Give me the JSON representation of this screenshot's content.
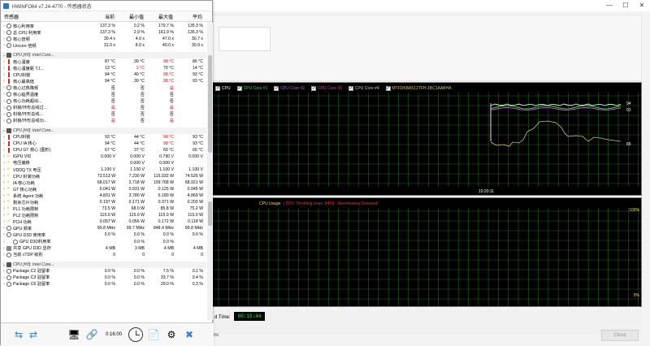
{
  "hwinfo": {
    "title": "HWiNFO64 v7.24-4770 - 传感器状态",
    "columns": [
      "传感器",
      "当前",
      "最小值",
      "最大值",
      "平均"
    ],
    "rows": [
      {
        "type": "item",
        "icon": "circle",
        "name": "核心利用率",
        "v": [
          "137.3 %",
          "0.2 %",
          "179.7 %",
          "135.3 %"
        ],
        "red": []
      },
      {
        "type": "item",
        "icon": "circle",
        "name": "总 CPU 利用率",
        "v": [
          "137.3 %",
          "2.9 %",
          "161.9 %",
          "135.3 %"
        ],
        "red": []
      },
      {
        "type": "item",
        "icon": "circle",
        "name": "核心倍频",
        "v": [
          "30.4 x",
          "4.0 x",
          "47.0 x",
          "30.7 x"
        ],
        "red": []
      },
      {
        "type": "item",
        "icon": "circle",
        "name": "Uncore 倍频",
        "v": [
          "31.0 x",
          "8.0 x",
          "40.0 x",
          "30.9 x"
        ],
        "red": []
      },
      {
        "type": "blank"
      },
      {
        "type": "group",
        "name": "CPU [#0]: Intel Core..."
      },
      {
        "type": "item",
        "icon": "therm",
        "name": "核心温度",
        "v": [
          "87 °C",
          "30 °C",
          "98 °C",
          "86 °C"
        ],
        "red": [
          2
        ]
      },
      {
        "type": "item",
        "icon": "therm",
        "name": "核心温度距 TJ...",
        "v": [
          "13 °C",
          "2 °C",
          "70 °C",
          "14 °C"
        ],
        "red": [
          1
        ]
      },
      {
        "type": "item",
        "icon": "therm",
        "name": "CPU封装",
        "v": [
          "94 °C",
          "40 °C",
          "98 °C",
          "93 °C"
        ],
        "red": [
          2
        ]
      },
      {
        "type": "item",
        "icon": "therm",
        "name": "核心最高值",
        "v": [
          "94 °C",
          "39 °C",
          "98 °C",
          "93 °C"
        ],
        "red": [
          2
        ]
      },
      {
        "type": "item",
        "icon": "circle",
        "name": "核心过热降频",
        "v": [
          "否",
          "否",
          "是",
          ""
        ],
        "red": [
          2
        ]
      },
      {
        "type": "item",
        "icon": "circle",
        "name": "核心临界温度",
        "v": [
          "否",
          "否",
          "否",
          ""
        ],
        "red": []
      },
      {
        "type": "item",
        "icon": "circle",
        "name": "核心功耗超出...",
        "v": [
          "否",
          "否",
          "否",
          ""
        ],
        "red": []
      },
      {
        "type": "item",
        "icon": "circle",
        "name": "封装/环形总线过...",
        "v": [
          "是",
          "否",
          "是",
          ""
        ],
        "red": [
          0,
          2
        ]
      },
      {
        "type": "item",
        "icon": "circle",
        "name": "封装/环形总线...",
        "v": [
          "否",
          "否",
          "否",
          ""
        ],
        "red": []
      },
      {
        "type": "item",
        "icon": "circle",
        "name": "封装/环形总线功...",
        "v": [
          "是",
          "否",
          "是",
          ""
        ],
        "red": [
          0,
          2
        ]
      },
      {
        "type": "blank"
      },
      {
        "type": "group",
        "name": "CPU [#0]: Intel Core..."
      },
      {
        "type": "item",
        "icon": "therm",
        "name": "CPU封装",
        "v": [
          "93 °C",
          "44 °C",
          "98 °C",
          "93 °C"
        ],
        "red": [
          2
        ]
      },
      {
        "type": "item",
        "icon": "therm",
        "name": "CPU IA 核心",
        "v": [
          "94 °C",
          "44 °C",
          "98 °C",
          "93 °C"
        ],
        "red": [
          2
        ]
      },
      {
        "type": "item",
        "icon": "therm",
        "name": "CPU GT 核心 (图形)",
        "v": [
          "67 °C",
          "37 °C",
          "69 °C",
          "65 °C"
        ],
        "red": []
      },
      {
        "type": "item",
        "icon": "bolt",
        "name": "iGPU VID",
        "v": [
          "0.000 V",
          "0.000 V",
          "0.790 V",
          "0.000 V"
        ],
        "red": []
      },
      {
        "type": "item",
        "icon": "bolt",
        "name": "电压偏移",
        "v": [
          "",
          "0.000 V",
          "0.000 V",
          ""
        ],
        "red": []
      },
      {
        "type": "item",
        "icon": "bolt",
        "name": "VDDQ TX 电压",
        "v": [
          "1.100 V",
          "1.100 V",
          "1.100 V",
          "1.100 V"
        ],
        "red": []
      },
      {
        "type": "item",
        "icon": "bolt",
        "name": "CPU 封装功耗",
        "v": [
          "73.513 W",
          "7.230 W",
          "115.032 W",
          "74.525 W"
        ],
        "red": []
      },
      {
        "type": "item",
        "icon": "bolt",
        "name": "IA 核心功耗",
        "v": [
          "68.017 W",
          "2.718 W",
          "109.768 W",
          "68.921 W"
        ],
        "red": []
      },
      {
        "type": "item",
        "icon": "bolt",
        "name": "GT 核心功耗",
        "v": [
          "0.041 W",
          "0.031 W",
          "0.125 W",
          "0.045 W"
        ],
        "red": []
      },
      {
        "type": "item",
        "icon": "bolt",
        "name": "系统 Agent 功耗",
        "v": [
          "4.831 W",
          "3.780 W",
          "6.180 W",
          "4.869 W"
        ],
        "red": []
      },
      {
        "type": "item",
        "icon": "bolt",
        "name": "剩余芯片功耗",
        "v": [
          "0.197 W",
          "0.171 W",
          "0.371 W",
          "0.203 W"
        ],
        "red": []
      },
      {
        "type": "item",
        "icon": "bolt",
        "name": "PL1 功耗限制",
        "v": [
          "73.5 W",
          "68.0 W",
          "85.8 W",
          "75.2 W"
        ],
        "red": []
      },
      {
        "type": "item",
        "icon": "bolt",
        "name": "PL2 功耗限制",
        "v": [
          "115.0 W",
          "115.0 W",
          "115.0 W",
          "115.0 W"
        ],
        "red": []
      },
      {
        "type": "item",
        "icon": "bolt",
        "name": "PCH 功耗",
        "v": [
          "0.057 W",
          "0.056 W",
          "0.172 W",
          "0.118 W"
        ],
        "red": []
      },
      {
        "type": "item",
        "icon": "circle",
        "name": "GPU 频率",
        "v": [
          "99.8 MHz",
          "99.7 MHz",
          "848.4 MHz",
          "99.8 MHz"
        ],
        "red": []
      },
      {
        "type": "item",
        "icon": "circle",
        "name": "GPU D3D 使用率",
        "v": [
          "0.0 %",
          "0.0 %",
          "0.0 %",
          "0.0 %"
        ],
        "red": []
      },
      {
        "type": "item",
        "icon": "circle",
        "name": "GPU D3D利用率",
        "v": [
          "",
          "0.0 %",
          "0.0 %",
          ""
        ],
        "red": [],
        "indent": true
      },
      {
        "type": "item",
        "icon": "box",
        "name": "共享 GPU D3D 显存",
        "v": [
          "4 MB",
          "3 MB",
          "4 MB",
          "4 MB"
        ],
        "red": []
      },
      {
        "type": "item",
        "icon": "circle",
        "name": "当前 cTDP 级别",
        "v": [
          "0",
          "0",
          "0",
          "0"
        ],
        "red": []
      },
      {
        "type": "blank"
      },
      {
        "type": "group",
        "name": "CPU [#0]: Intel Core..."
      },
      {
        "type": "item",
        "icon": "circle",
        "name": "Package C2 驻留率",
        "v": [
          "0.0 %",
          "0.0 %",
          "7.5 %",
          "0.1 %"
        ],
        "red": []
      },
      {
        "type": "item",
        "icon": "circle",
        "name": "Package C3 驻留率",
        "v": [
          "0.0 %",
          "0.0 %",
          "33.7 %",
          "0.4 %"
        ],
        "red": []
      },
      {
        "type": "item",
        "icon": "circle",
        "name": "Package C6 驻留率",
        "v": [
          "0.0 %",
          "0.0 %",
          "29.0 %",
          "0.3 %"
        ],
        "red": []
      }
    ],
    "toolbar": {
      "timer": "0:16:00"
    }
  },
  "stability": {
    "legend": [
      {
        "label": "CPU",
        "color": "#ffffff"
      },
      {
        "label": "CPU Core #1",
        "color": "#39d839"
      },
      {
        "label": "CPU Core #2",
        "color": "#c84fe0"
      },
      {
        "label": "CPU Core #3",
        "color": "#e040a0"
      },
      {
        "label": "CPU Core #4",
        "color": "#c8c8c8"
      },
      {
        "label": "MTFDKBA512TFH-1BC1AABHA",
        "color": "#e0c060"
      }
    ],
    "graph1_values": [
      "94",
      "93",
      "65"
    ],
    "time_label": "10:20:11",
    "usage_title": "CPU Usage",
    "throttle_text": "CPU Throttling (max: 54%) - Overheating Detected!",
    "pct_top": "100%",
    "pct_bottom": "0%",
    "elapsed_label": "d Time:",
    "elapsed_value": "00:15:44",
    "partial_text": "ions",
    "close_label": "Close"
  }
}
